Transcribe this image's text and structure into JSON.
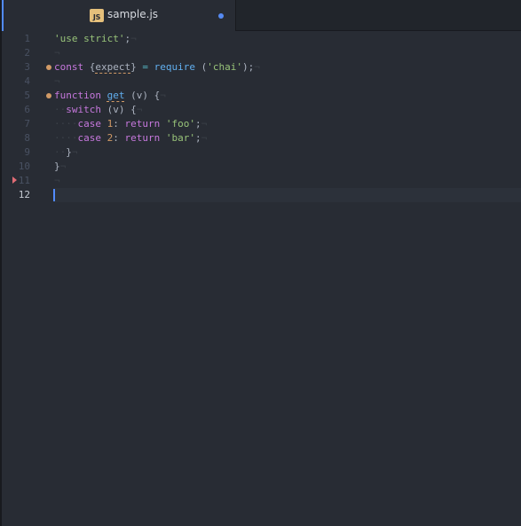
{
  "tab": {
    "icon_label": "JS",
    "title": "sample.js",
    "modified": true
  },
  "colors": {
    "background": "#282c34",
    "accent": "#528bff",
    "string": "#98c379",
    "keyword": "#c678dd",
    "function": "#61afef",
    "number": "#d19a66",
    "operator": "#56b6c2",
    "lint_marker": "#d19a66",
    "fold_arrow": "#e06c75"
  },
  "editor": {
    "cursor_line": 12,
    "lines": [
      {
        "number": "1",
        "marker": false,
        "tokens": [
          {
            "t": "str",
            "v": "'use strict'"
          },
          {
            "t": "plain",
            "v": ";"
          },
          {
            "t": "eol",
            "v": "¬"
          }
        ]
      },
      {
        "number": "2",
        "marker": false,
        "tokens": [
          {
            "t": "eol",
            "v": "¬"
          }
        ]
      },
      {
        "number": "3",
        "marker": true,
        "tokens": [
          {
            "t": "kw",
            "v": "const"
          },
          {
            "t": "plain",
            "v": " {"
          },
          {
            "t": "lint",
            "v": "expect"
          },
          {
            "t": "plain",
            "v": "} "
          },
          {
            "t": "op",
            "v": "="
          },
          {
            "t": "plain",
            "v": " "
          },
          {
            "t": "fn",
            "v": "require"
          },
          {
            "t": "plain",
            "v": " ("
          },
          {
            "t": "str",
            "v": "'chai'"
          },
          {
            "t": "plain",
            "v": ");"
          },
          {
            "t": "eol",
            "v": "¬"
          }
        ]
      },
      {
        "number": "4",
        "marker": false,
        "tokens": [
          {
            "t": "eol",
            "v": "¬"
          }
        ]
      },
      {
        "number": "5",
        "marker": true,
        "tokens": [
          {
            "t": "kw",
            "v": "function"
          },
          {
            "t": "plain",
            "v": " "
          },
          {
            "t": "lintfn",
            "v": "get"
          },
          {
            "t": "plain",
            "v": " (v) {"
          },
          {
            "t": "eol",
            "v": "¬"
          }
        ]
      },
      {
        "number": "6",
        "marker": false,
        "tokens": [
          {
            "t": "ind",
            "v": "··"
          },
          {
            "t": "kw",
            "v": "switch"
          },
          {
            "t": "plain",
            "v": " (v) {"
          },
          {
            "t": "eol",
            "v": "¬"
          }
        ]
      },
      {
        "number": "7",
        "marker": false,
        "tokens": [
          {
            "t": "ind",
            "v": "····"
          },
          {
            "t": "kw",
            "v": "case"
          },
          {
            "t": "plain",
            "v": " "
          },
          {
            "t": "num",
            "v": "1"
          },
          {
            "t": "plain",
            "v": ": "
          },
          {
            "t": "kw",
            "v": "return"
          },
          {
            "t": "plain",
            "v": " "
          },
          {
            "t": "str",
            "v": "'foo'"
          },
          {
            "t": "plain",
            "v": ";"
          },
          {
            "t": "eol",
            "v": "¬"
          }
        ]
      },
      {
        "number": "8",
        "marker": false,
        "tokens": [
          {
            "t": "ind",
            "v": "····"
          },
          {
            "t": "kw",
            "v": "case"
          },
          {
            "t": "plain",
            "v": " "
          },
          {
            "t": "num",
            "v": "2"
          },
          {
            "t": "plain",
            "v": ": "
          },
          {
            "t": "kw",
            "v": "return"
          },
          {
            "t": "plain",
            "v": " "
          },
          {
            "t": "str",
            "v": "'bar'"
          },
          {
            "t": "plain",
            "v": ";"
          },
          {
            "t": "eol",
            "v": "¬"
          }
        ]
      },
      {
        "number": "9",
        "marker": false,
        "tokens": [
          {
            "t": "ind",
            "v": "··"
          },
          {
            "t": "plain",
            "v": "}"
          },
          {
            "t": "eol",
            "v": "¬"
          }
        ]
      },
      {
        "number": "10",
        "marker": false,
        "tokens": [
          {
            "t": "plain",
            "v": "}"
          },
          {
            "t": "eol",
            "v": "¬"
          }
        ]
      },
      {
        "number": "11",
        "marker": false,
        "tokens": [
          {
            "t": "eol",
            "v": "¬"
          }
        ]
      },
      {
        "number": "12",
        "marker": false,
        "tokens": []
      }
    ]
  }
}
